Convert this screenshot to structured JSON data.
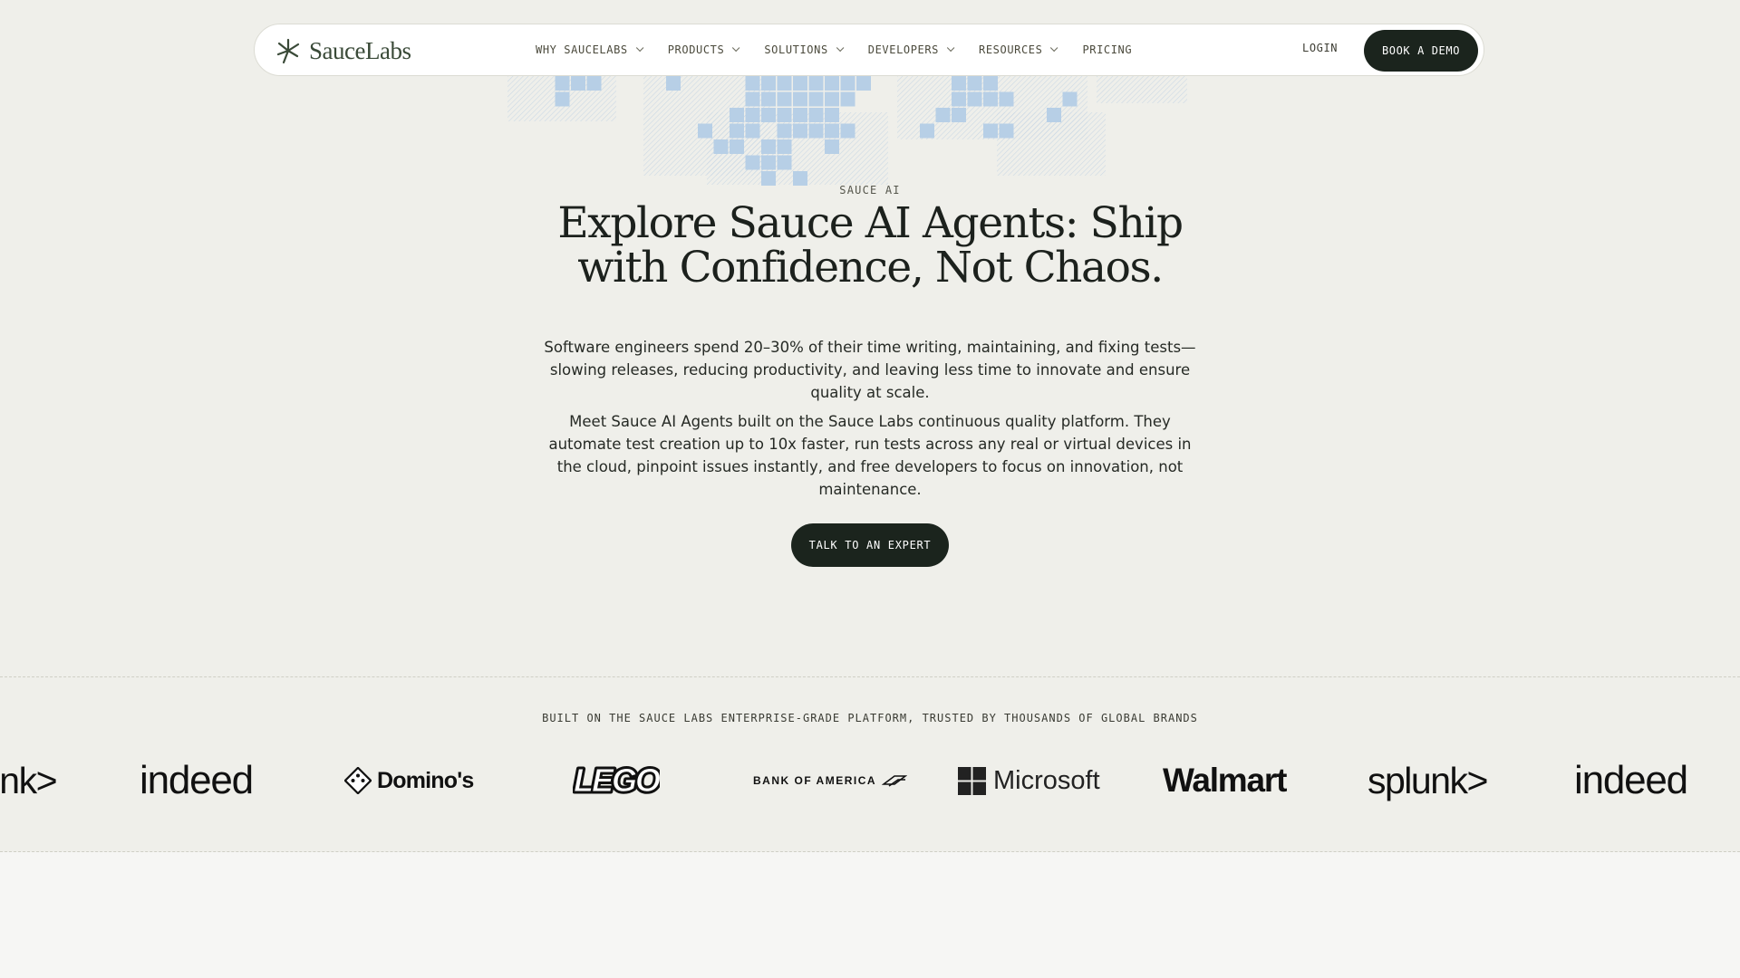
{
  "nav": {
    "logo_text": "SauceLabs",
    "menu": [
      {
        "label": "WHY SAUCELABS",
        "has_dropdown": true
      },
      {
        "label": "PRODUCTS",
        "has_dropdown": true
      },
      {
        "label": "SOLUTIONS",
        "has_dropdown": true
      },
      {
        "label": "DEVELOPERS",
        "has_dropdown": true
      },
      {
        "label": "RESOURCES",
        "has_dropdown": true
      },
      {
        "label": "PRICING",
        "has_dropdown": false
      }
    ],
    "login": "LOGIN",
    "demo_button": "BOOK A DEMO"
  },
  "hero": {
    "eyebrow": "SAUCE AI",
    "headline_line1": "Explore Sauce AI Agents: Ship",
    "headline_line2": "with Confidence, Not Chaos.",
    "paragraph1": "Software engineers spend 20–30% of their time writing, maintaining, and fixing tests—slowing releases, reducing productivity, and leaving less time to innovate and ensure quality at scale.",
    "paragraph2": "Meet Sauce AI Agents built on the Sauce Labs continuous quality platform. They automate test creation up to 10x faster, run tests across any real or virtual devices in the cloud, pinpoint issues instantly, and free developers to focus on innovation, not maintenance.",
    "cta": "TALK TO AN EXPERT"
  },
  "brands": {
    "caption": "BUILT ON THE SAUCE LABS ENTERPRISE-GRADE PLATFORM, TRUSTED BY THOUSANDS OF GLOBAL BRANDS",
    "logos": [
      "splunk",
      "indeed",
      "Domino's",
      "LEGO",
      "BANK OF AMERICA",
      "Microsoft",
      "Walmart",
      "splunk",
      "indeed"
    ]
  },
  "colors": {
    "page_bg": "#efefea",
    "dark_button": "#1b241d",
    "logo_green": "#3a4a38",
    "pixel_blue": "#b7cfe6",
    "footer_bg": "#f6f6f4"
  }
}
